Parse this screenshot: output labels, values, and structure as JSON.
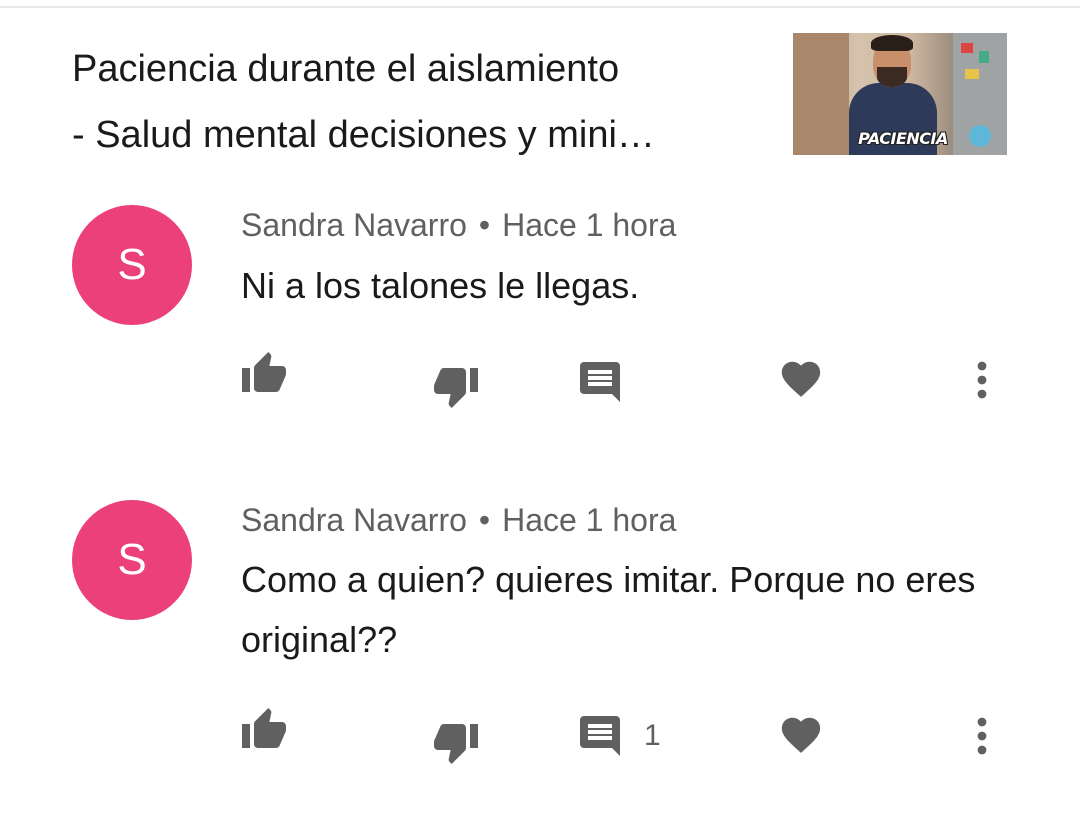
{
  "video": {
    "title": "Paciencia durante el aislamiento\n- Salud mental decisiones y mini…",
    "thumbnail_caption": "PACIENCIA"
  },
  "comments": [
    {
      "avatar_letter": "S",
      "avatar_color": "#ec407a",
      "author": "Sandra Navarro",
      "separator": "•",
      "time": "Hace 1 hora",
      "text": "Ni a los talones le llegas.",
      "reply_count": ""
    },
    {
      "avatar_letter": "S",
      "avatar_color": "#ec407a",
      "author": "Sandra Navarro",
      "separator": "•",
      "time": "Hace 1 hora",
      "text": "Como a quien? quieres imitar. Porque no eres original??",
      "reply_count": "1"
    }
  ],
  "icons": {
    "like": "thumb-up-icon",
    "dislike": "thumb-down-icon",
    "reply": "comment-icon",
    "heart": "heart-icon",
    "more": "more-vert-icon"
  },
  "colors": {
    "icon": "#606060",
    "avatar": "#ec407a",
    "text": "#1a1a1a",
    "meta": "#606060"
  }
}
